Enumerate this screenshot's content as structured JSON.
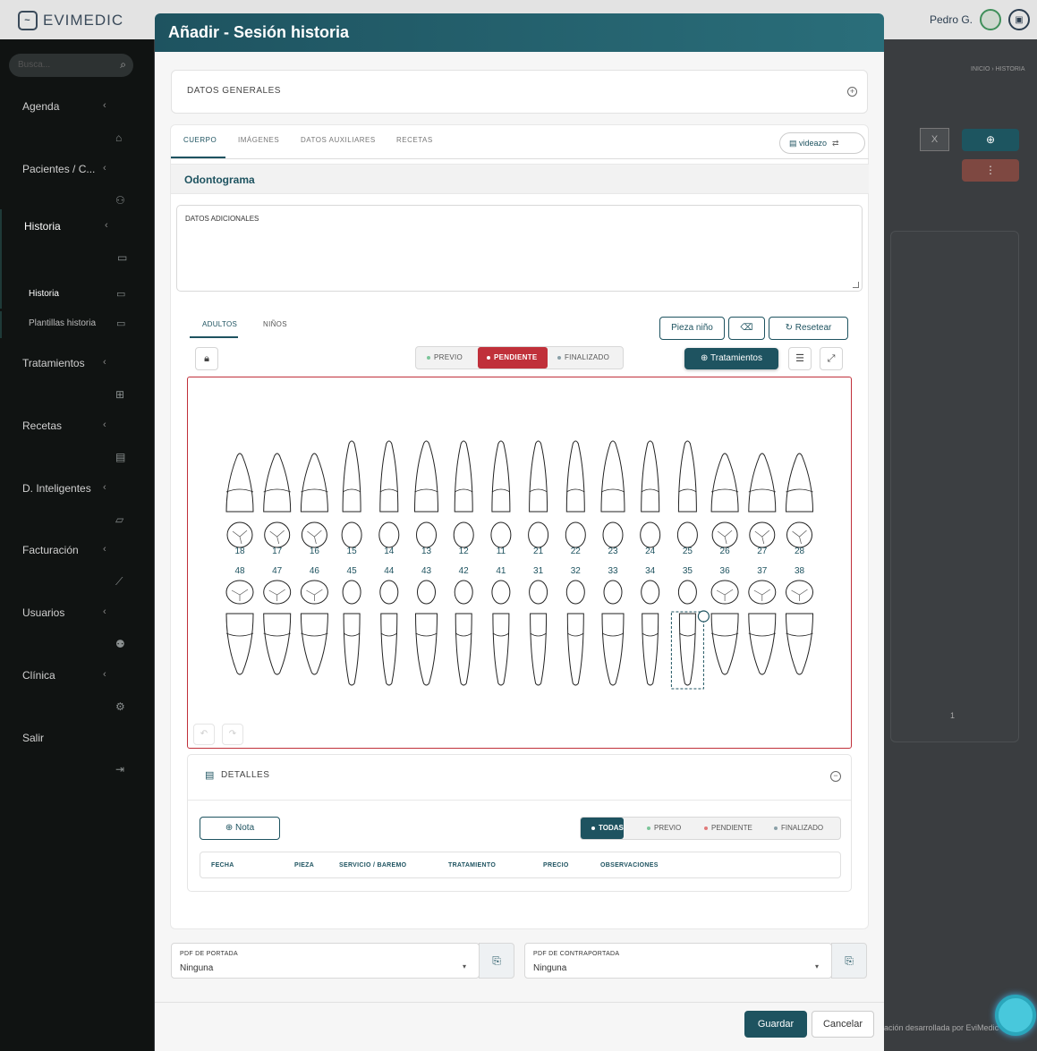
{
  "topbar": {
    "brand": "EVIMEDIC",
    "user_name": "Pedro G."
  },
  "sidebar": {
    "search_placeholder": "Busca...",
    "items": [
      {
        "label": "Agenda"
      },
      {
        "label": "Pacientes / C..."
      },
      {
        "label": "Historia"
      },
      {
        "label": "Tratamientos"
      },
      {
        "label": "Recetas"
      },
      {
        "label": "D. Inteligentes"
      },
      {
        "label": "Facturación"
      },
      {
        "label": "Usuarios"
      },
      {
        "label": "Clínica"
      },
      {
        "label": "Salir"
      }
    ],
    "sub_items": [
      {
        "label": "Historia"
      },
      {
        "label": "Plantillas historia"
      }
    ]
  },
  "background": {
    "breadcrumb": "INICIO  ›  HISTORIA",
    "clear_label": "X",
    "page_num": "1",
    "credit": "ación desarrollada por EviMedic"
  },
  "modal": {
    "title": "Añadir - Sesión historia",
    "general_section": "DATOS GENERALES",
    "tabs": [
      {
        "label": "CUERPO"
      },
      {
        "label": "IMÁGENES"
      },
      {
        "label": "DATOS AUXILIARES"
      },
      {
        "label": "RECETAS"
      }
    ],
    "videazo_label": "videazo",
    "odontogram_title": "Odontograma",
    "extra_data_label": "DATOS ADICIONALES",
    "subtabs": [
      {
        "label": "ADULTOS"
      },
      {
        "label": "NIÑOS"
      }
    ],
    "buttons": {
      "pieza_nino": "Pieza niño",
      "resetear": "Resetear",
      "tratamientos": "Tratamientos"
    },
    "status": [
      {
        "label": "PREVIO",
        "color": "#7cc59a"
      },
      {
        "label": "PENDIENTE",
        "color": "#ffffff"
      },
      {
        "label": "FINALIZADO",
        "color": "#8aa0a8"
      }
    ],
    "upper_teeth": [
      "18",
      "17",
      "16",
      "15",
      "14",
      "13",
      "12",
      "11",
      "21",
      "22",
      "23",
      "24",
      "25",
      "26",
      "27",
      "28"
    ],
    "lower_teeth": [
      "48",
      "47",
      "46",
      "45",
      "44",
      "43",
      "42",
      "41",
      "31",
      "32",
      "33",
      "34",
      "35",
      "36",
      "37",
      "38"
    ],
    "selected_tooth": "35",
    "details": {
      "title": "DETALLES",
      "note_button": "Nota",
      "filters": [
        {
          "label": "TODAS"
        },
        {
          "label": "PREVIO",
          "color": "#7cc59a"
        },
        {
          "label": "PENDIENTE",
          "color": "#e07a7a"
        },
        {
          "label": "FINALIZADO",
          "color": "#8aa0a8"
        }
      ],
      "columns": [
        "FECHA",
        "PIEZA",
        "SERVICIO / BAREMO",
        "TRATAMIENTO",
        "PRECIO",
        "OBSERVACIONES"
      ]
    },
    "pdf_cover": {
      "label": "PDF DE PORTADA",
      "value": "Ninguna"
    },
    "pdf_back": {
      "label": "PDF DE CONTRAPORTADA",
      "value": "Ninguna"
    },
    "save_label": "Guardar",
    "cancel_label": "Cancelar"
  }
}
